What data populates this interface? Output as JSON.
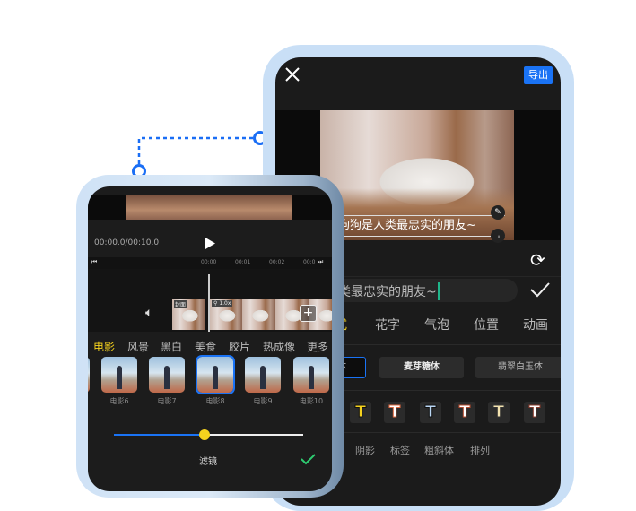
{
  "back_phone": {
    "export_label": "导出",
    "subtitle": "狗狗是人类最忠实的朋友~",
    "input_text": "类最忠实的朋友~",
    "tabs": [
      "式",
      "花字",
      "气泡",
      "位置",
      "动画"
    ],
    "fonts": [
      "体",
      "麦芽糖体",
      "翡翠白玉体"
    ],
    "text_styles": [
      {
        "color": "#f5d21e",
        "stroke": "#111"
      },
      {
        "color": "#ffffff",
        "stroke": "#e0683f"
      },
      {
        "color": "#bcd8f5",
        "stroke": "#111"
      },
      {
        "color": "#ffffff",
        "stroke": "#b5492b"
      },
      {
        "color": "#f3e3b0",
        "stroke": "#333"
      },
      {
        "color": "#ffffff",
        "stroke": "#8a3a2a"
      }
    ],
    "bottom_tabs": [
      "阴影",
      "标签",
      "粗斜体",
      "排列"
    ]
  },
  "front_phone": {
    "time": "00:00.0/00:10.0",
    "ruler": [
      "00:00",
      "00:01",
      "00:02",
      "00:0"
    ],
    "cover_label": "封面",
    "speed_label": "1.0x",
    "filter_tabs": [
      "电影",
      "风景",
      "黑白",
      "美食",
      "胶片",
      "热成像",
      "更多"
    ],
    "filters": [
      "电影6",
      "电影7",
      "电影8",
      "电影9",
      "电影10"
    ],
    "selected_filter": "电影8",
    "intensity": 0.48,
    "title": "滤镜"
  },
  "colors": {
    "accent": "#1a73f5",
    "active_tab": "#f5d21e",
    "confirm": "#2ecc71"
  }
}
